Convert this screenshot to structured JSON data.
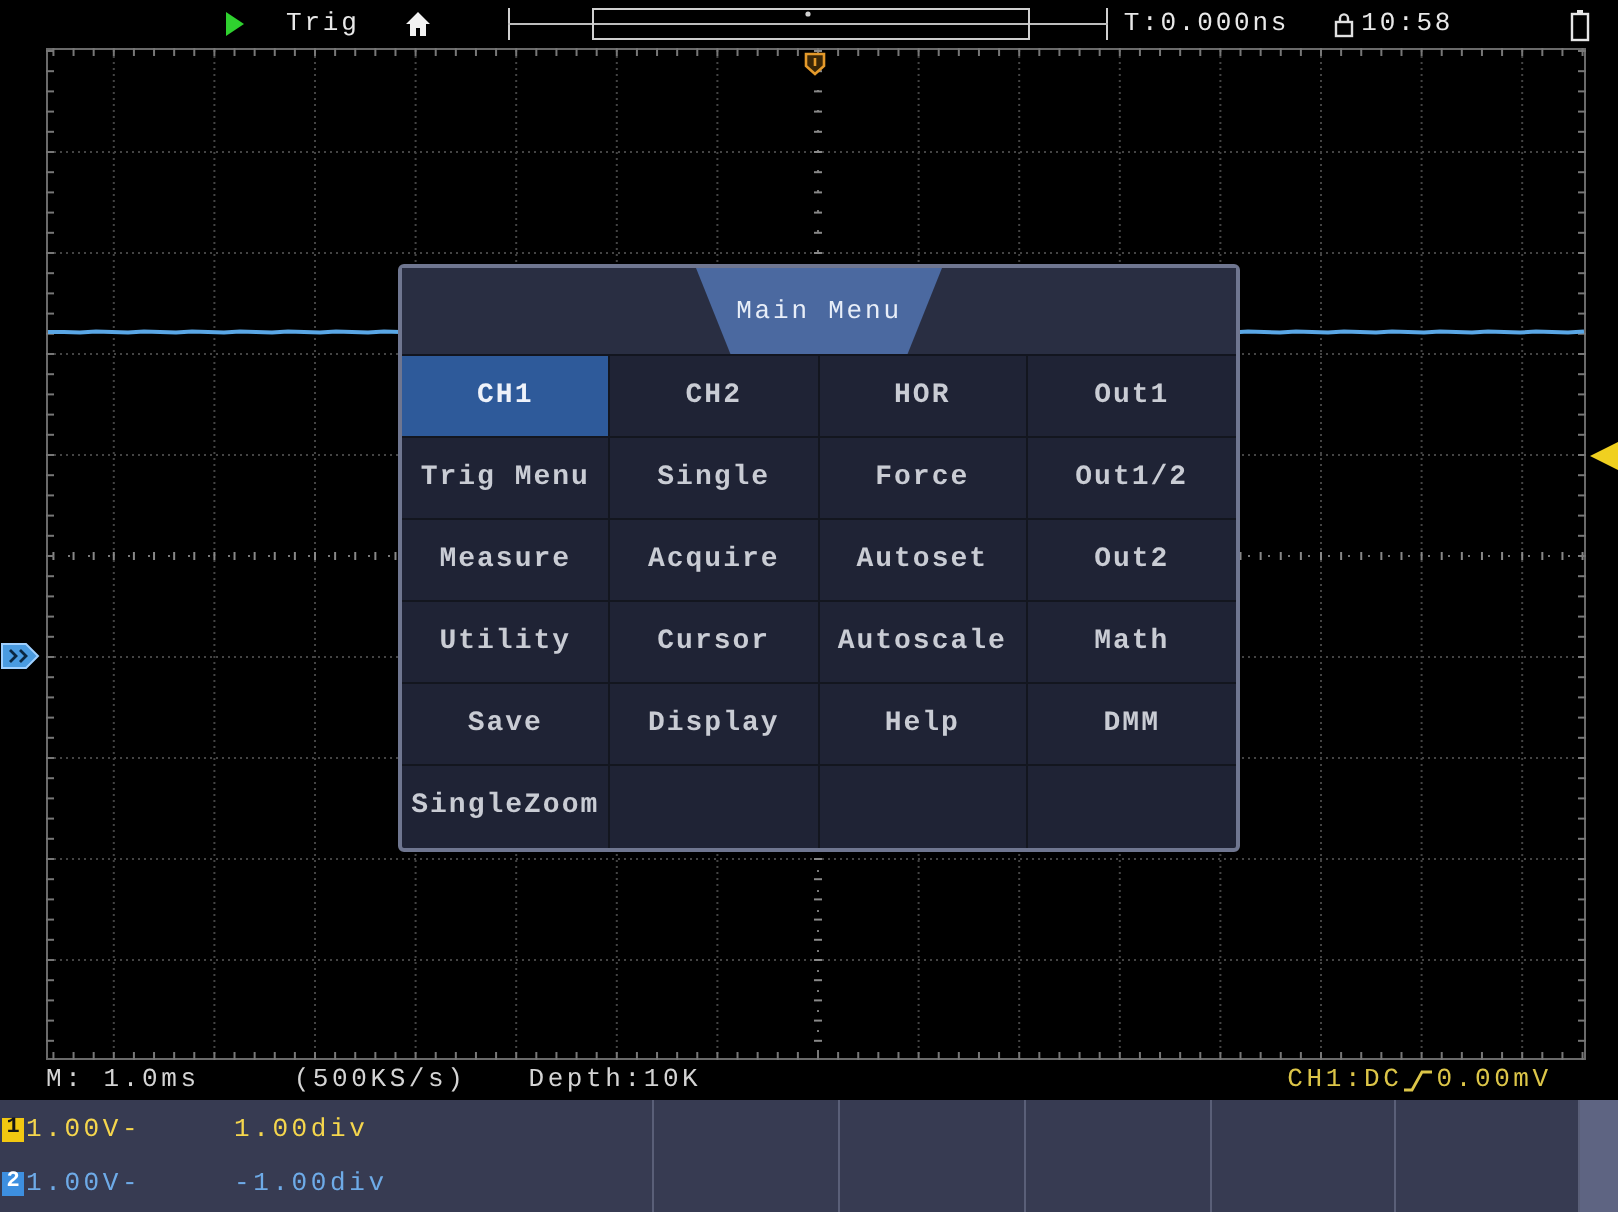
{
  "top_bar": {
    "running": true,
    "trigger_state": "Trig",
    "time_offset": "T:0.000ns",
    "clock": "10:58"
  },
  "main_menu": {
    "title": "Main Menu",
    "items": [
      {
        "label": "CH1",
        "selected": true
      },
      {
        "label": "CH2",
        "selected": false
      },
      {
        "label": "HOR",
        "selected": false
      },
      {
        "label": "Out1",
        "selected": false
      },
      {
        "label": "Trig Menu",
        "selected": false
      },
      {
        "label": "Single",
        "selected": false
      },
      {
        "label": "Force",
        "selected": false
      },
      {
        "label": "Out1/2",
        "selected": false
      },
      {
        "label": "Measure",
        "selected": false
      },
      {
        "label": "Acquire",
        "selected": false
      },
      {
        "label": "Autoset",
        "selected": false
      },
      {
        "label": "Out2",
        "selected": false
      },
      {
        "label": "Utility",
        "selected": false
      },
      {
        "label": "Cursor",
        "selected": false
      },
      {
        "label": "Autoscale",
        "selected": false
      },
      {
        "label": "Math",
        "selected": false
      },
      {
        "label": "Save",
        "selected": false
      },
      {
        "label": "Display",
        "selected": false
      },
      {
        "label": "Help",
        "selected": false
      },
      {
        "label": "DMM",
        "selected": false
      },
      {
        "label": "SingleZoom",
        "selected": false
      }
    ]
  },
  "status_line": {
    "timebase": "M: 1.0ms",
    "sample_rate": "(500KS/s)",
    "depth": "Depth:10K",
    "trigger_source": "CH1:DC",
    "trigger_level": "0.00mV"
  },
  "channels": [
    {
      "badge": "1",
      "scale": "1.00V-",
      "offset": "1.00div",
      "color": "#f2c811"
    },
    {
      "badge": "2",
      "scale": "1.00V-",
      "offset": "-1.00div",
      "color": "#3d8fe0"
    }
  ]
}
